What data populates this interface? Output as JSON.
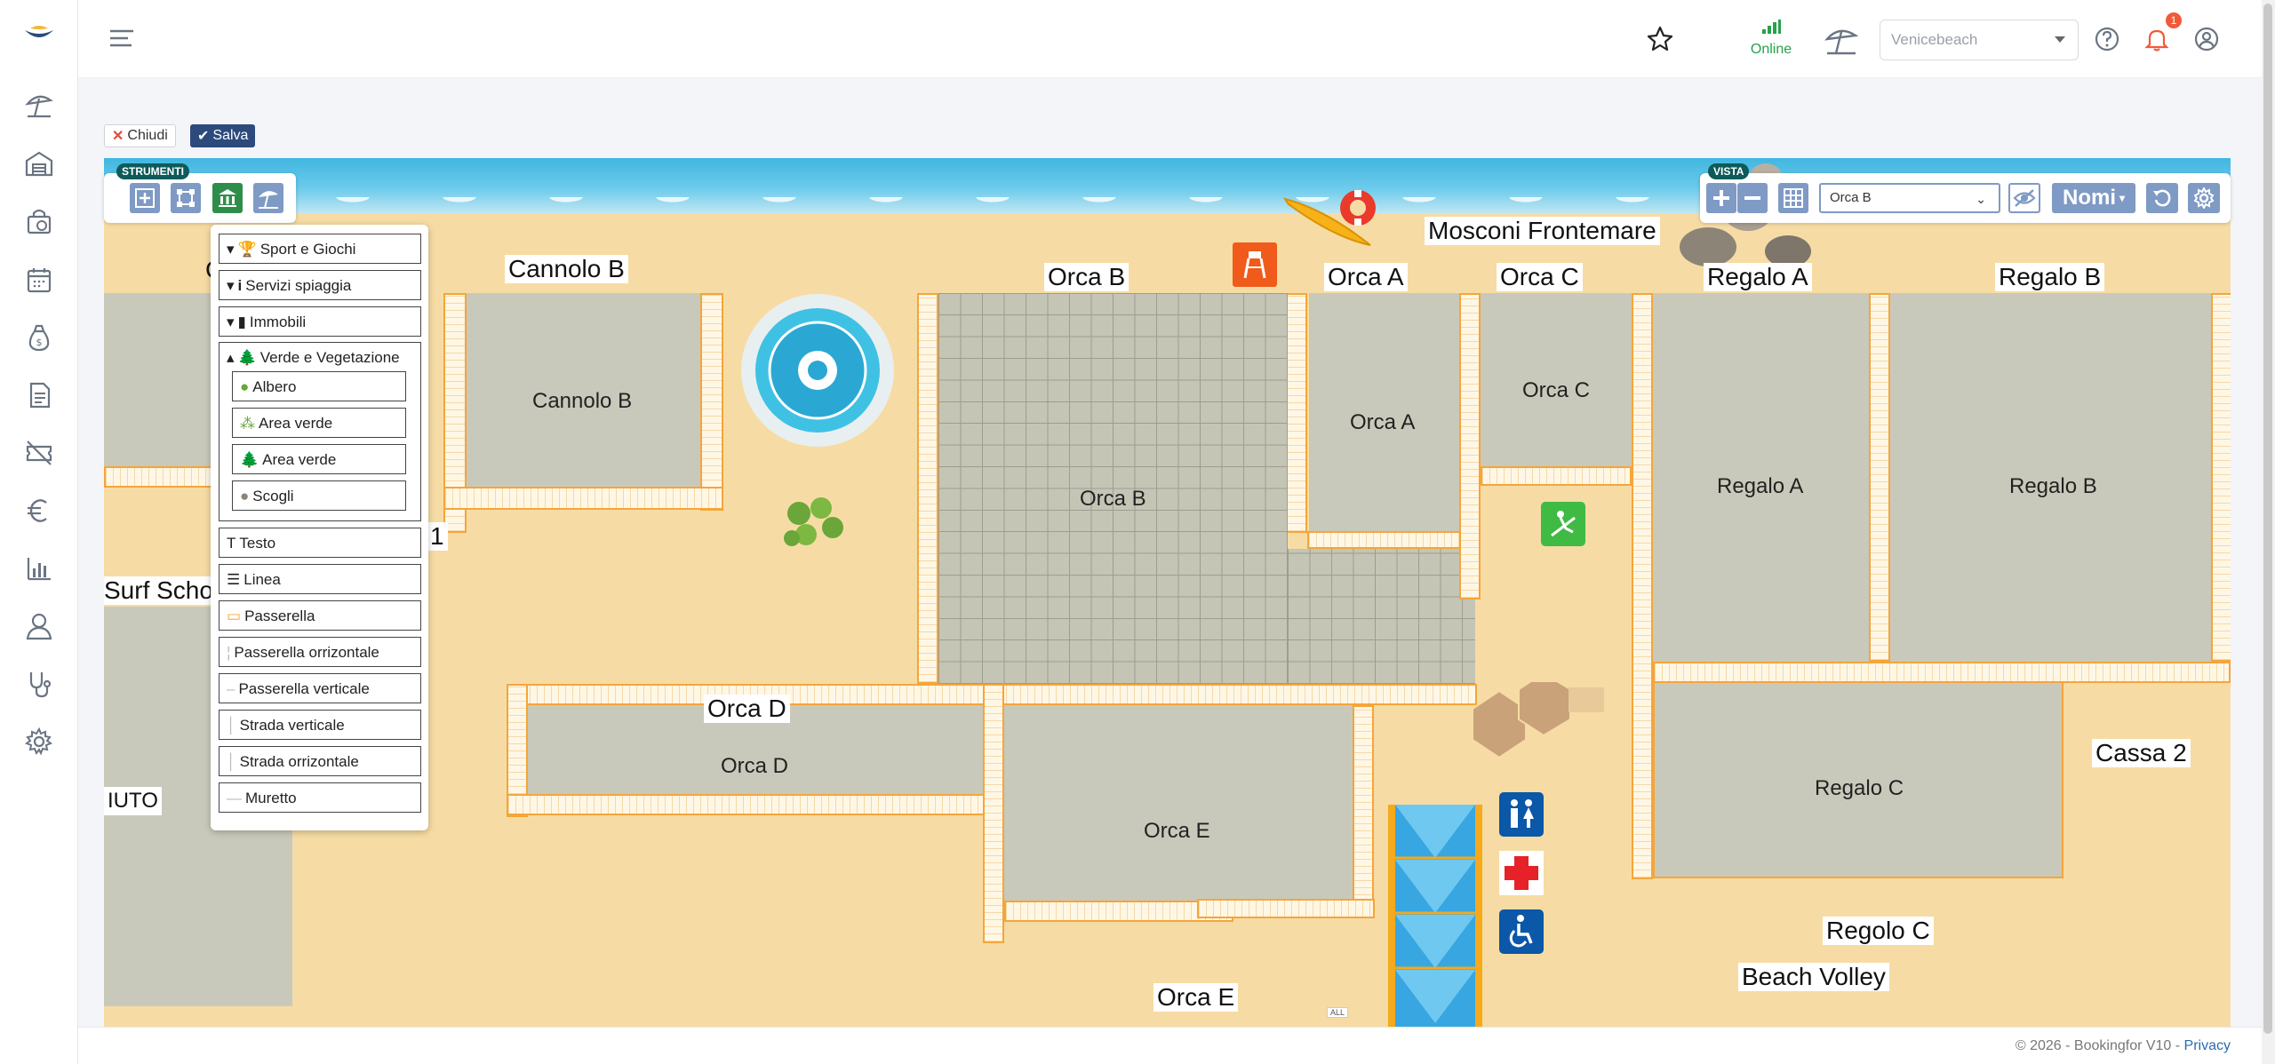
{
  "header": {
    "status": "Online",
    "site_select": "Venicebeach",
    "notifications_count": "1"
  },
  "actions": {
    "close_label": "Chiudi",
    "save_label": "Salva"
  },
  "toolbar": {
    "tools_title": "STRUMENTI",
    "view_title": "VISTA",
    "zone_select": "Orca B",
    "names_label": "Nomi"
  },
  "tools_menu": {
    "sport": "Sport e Giochi",
    "services": "Servizi spiaggia",
    "buildings": "Immobili",
    "green": "Verde e Vegetazione",
    "tree": "Albero",
    "green_area_1": "Area verde",
    "green_area_2": "Area verde",
    "rocks": "Scogli",
    "text": "Testo",
    "line": "Linea",
    "walkway": "Passerella",
    "walkway_h": "Passerella orrizontale",
    "walkway_v": "Passerella verticale",
    "road_v": "Strada verticale",
    "road_h": "Strada orrizontale",
    "wall": "Muretto"
  },
  "map": {
    "labels": {
      "cannolo_b_top": "Cannolo B",
      "orca_b_top": "Orca B",
      "orca_a_top": "Orca A",
      "orca_c_top": "Orca C",
      "regalo_a_top": "Regalo A",
      "regalo_b_top": "Regalo B",
      "mosconi": "Mosconi Frontemare",
      "surf": "Surf Scho",
      "iuto": "IUTO",
      "orca_d_top": "Orca D",
      "orca_e_bottom": "Orca E",
      "cassa2": "Cassa 2",
      "regolo_c": "Regolo C",
      "beach_volley": "Beach Volley",
      "one": "1",
      "c_letter": "C"
    },
    "zones": {
      "cannolo_b": "Cannolo B",
      "orca_a": "Orca A",
      "orca_b": "Orca B",
      "orca_c": "Orca C",
      "regalo_a": "Regalo A",
      "regalo_b": "Regalo B",
      "orca_d": "Orca D",
      "orca_e": "Orca E",
      "regalo_c": "Regalo C"
    },
    "small_tag": "ALL"
  },
  "footer": {
    "copyright": "© 2026 - Bookingfor V10 - ",
    "privacy": "Privacy"
  },
  "colors": {
    "accent": "#2c4a7c",
    "tool_button": "#7f9ac4",
    "walkway_border": "#f5a53a",
    "sand": "#f6dca4",
    "sea": "#41b6e0"
  }
}
